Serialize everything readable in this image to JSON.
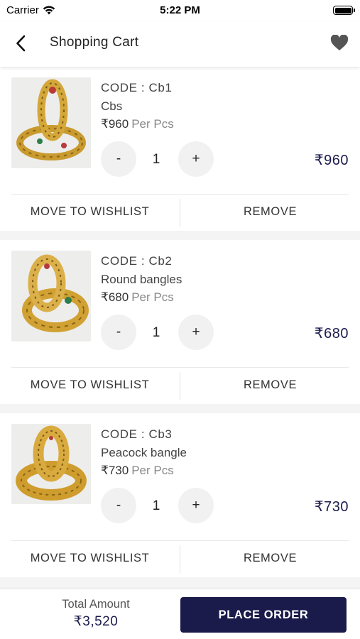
{
  "status_bar": {
    "carrier": "Carrier",
    "time": "5:22 PM"
  },
  "nav": {
    "title": "Shopping Cart",
    "back_icon": "chevron-left-icon",
    "wishlist_icon": "heart-icon"
  },
  "cart": {
    "currency": "₹",
    "items": [
      {
        "code": "CODE : Cb1",
        "name": "Cbs",
        "price": "₹960",
        "unit": "Per Pcs",
        "minus": "-",
        "qty": "1",
        "plus": "+",
        "total": "₹960",
        "move_label": "MOVE TO WISHLIST",
        "remove_label": "REMOVE"
      },
      {
        "code": "CODE : Cb2",
        "name": "Round bangles",
        "price": "₹680",
        "unit": "Per Pcs",
        "minus": "-",
        "qty": "1",
        "plus": "+",
        "total": "₹680",
        "move_label": "MOVE TO WISHLIST",
        "remove_label": "REMOVE"
      },
      {
        "code": "CODE : Cb3",
        "name": "Peacock bangle",
        "price": "₹730",
        "unit": "Per Pcs",
        "minus": "-",
        "qty": "1",
        "plus": "+",
        "total": "₹730",
        "move_label": "MOVE TO WISHLIST",
        "remove_label": "REMOVE"
      }
    ]
  },
  "footer": {
    "total_label": "Total Amount",
    "total_value": "₹3,520",
    "place_order_label": "PLACE ORDER"
  },
  "colors": {
    "accent": "#1b1b4b",
    "price": "#1c1c4d",
    "qty_button_bg": "#f1f1f1",
    "gold": "#c99a2e"
  }
}
